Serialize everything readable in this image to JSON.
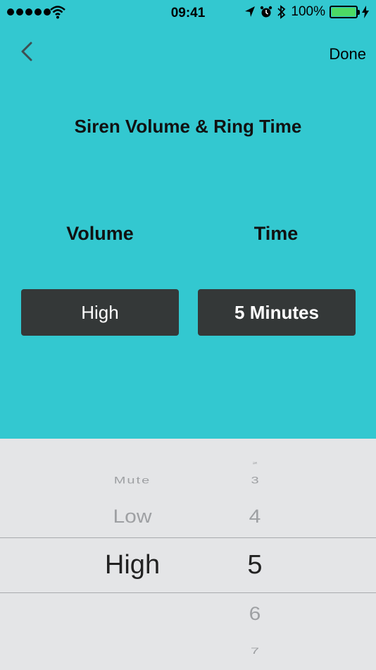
{
  "status_bar": {
    "time": "09:41",
    "battery_percent": "100%",
    "battery_level": 1.0,
    "icons": [
      "signal-dots-icon",
      "wifi-icon",
      "location-arrow-icon",
      "alarm-icon",
      "bluetooth-icon",
      "battery-icon",
      "charging-bolt-icon"
    ]
  },
  "nav": {
    "back_icon": "chevron-left-icon",
    "done_label": "Done"
  },
  "page_title": "Siren Volume & Ring Time",
  "columns": {
    "volume_label": "Volume",
    "time_label": "Time"
  },
  "selection": {
    "volume_value": "High",
    "time_value": "5 Minutes"
  },
  "picker": {
    "volume_items": [
      "Mute",
      "Low",
      "High"
    ],
    "volume_selected": "High",
    "minute_items": [
      "2",
      "3",
      "4",
      "5",
      "6",
      "7"
    ],
    "minute_selected": "5"
  },
  "colors": {
    "background": "#33c8d0",
    "button_bg": "#343838",
    "picker_bg": "#e4e5e7",
    "battery_fill": "#4cd964"
  }
}
